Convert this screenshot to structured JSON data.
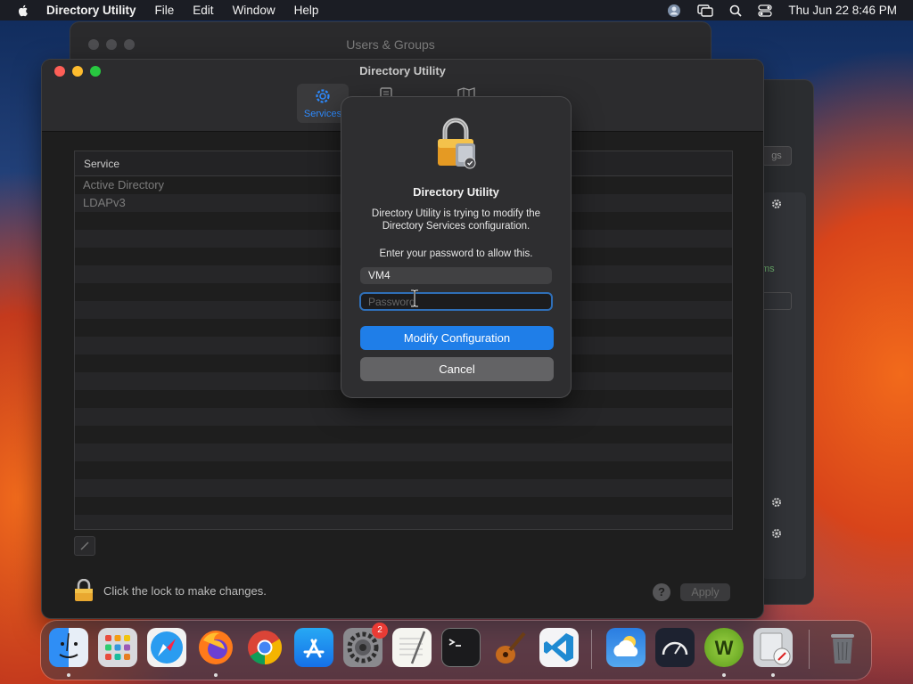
{
  "menubar": {
    "app_name": "Directory Utility",
    "items": [
      "File",
      "Edit",
      "Window",
      "Help"
    ],
    "datetime": "Thu Jun 22  8:46 PM"
  },
  "background_window": {
    "title": "Users & Groups",
    "button_text": "gs",
    "green_text": "ms"
  },
  "main_window": {
    "title": "Directory Utility",
    "toolbar": {
      "services_label": "Services"
    },
    "table": {
      "header": "Service",
      "rows": [
        "Active Directory",
        "LDAPv3"
      ]
    },
    "lock_text": "Click the lock to make changes.",
    "help_label": "?",
    "apply_label": "Apply"
  },
  "dialog": {
    "title": "Directory Utility",
    "message": "Directory Utility is trying to modify the Directory Services configuration.",
    "prompt": "Enter your password to allow this.",
    "username": "VM4",
    "password_placeholder": "Password",
    "primary_button": "Modify Configuration",
    "cancel_button": "Cancel"
  },
  "dock": {
    "apps": [
      "Finder",
      "Launchpad",
      "Safari",
      "Firefox",
      "Chrome",
      "App Store",
      "System Settings",
      "TextEdit",
      "Terminal",
      "GarageBand",
      "Visual Studio Code",
      "Weather",
      "Activity Monitor",
      "W",
      "Directory Utility",
      "Trash"
    ],
    "settings_badge": "2"
  },
  "colors": {
    "accent": "#1f7ee8",
    "focus_ring": "#2f6fb8"
  }
}
